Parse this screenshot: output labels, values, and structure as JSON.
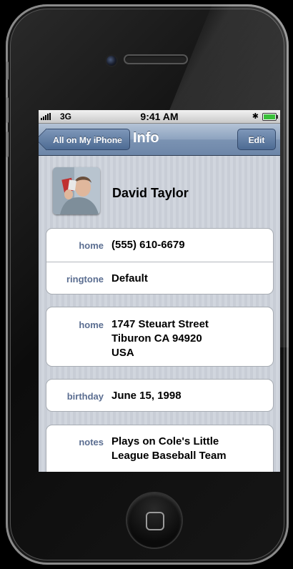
{
  "status_bar": {
    "carrier": "3G",
    "time": "9:41 AM",
    "bluetooth_icon": "bluetooth-icon",
    "battery_icon": "battery-icon",
    "battery_level": 1.0
  },
  "nav_bar": {
    "back_label": "All on My iPhone",
    "title": "Info",
    "edit_label": "Edit"
  },
  "contact": {
    "name": "David Taylor",
    "phone": {
      "label": "home",
      "value": "(555) 610-6679"
    },
    "ringtone": {
      "label": "ringtone",
      "value": "Default"
    },
    "address": {
      "label": "home",
      "line1": "1747 Steuart Street",
      "line2": "Tiburon CA 94920",
      "line3": "USA"
    },
    "birthday": {
      "label": "birthday",
      "value": "June 15, 1998"
    },
    "notes": {
      "label": "notes",
      "line1": "Plays on Cole's Little",
      "line2": "League Baseball Team"
    }
  },
  "colors": {
    "nav_bar": "#7b93b3",
    "field_label": "#5b6e91",
    "battery_fill": "#3ac03a"
  }
}
